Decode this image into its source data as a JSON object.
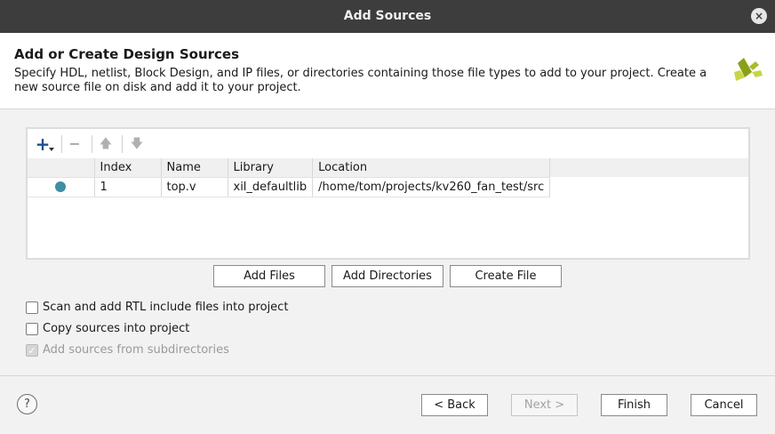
{
  "window": {
    "title": "Add Sources",
    "close_icon": "×"
  },
  "header": {
    "title": "Add or Create Design Sources",
    "description": "Specify HDL, netlist, Block Design, and IP files, or directories containing those file types to add to your project. Create a new source file on disk and add it to your project.",
    "logo_icon": "xilinx-logo-icon"
  },
  "toolbar": {
    "add_icon": "+",
    "remove_icon": "−",
    "up_icon": "🡅",
    "down_icon": "🡇"
  },
  "table": {
    "columns": [
      "",
      "Index",
      "Name",
      "Library",
      "Location"
    ],
    "rows": [
      {
        "status": "added",
        "index": "1",
        "name": "top.v",
        "library": "xil_defaultlib",
        "location": "/home/tom/projects/kv260_fan_test/src"
      }
    ]
  },
  "actions": {
    "add_files": "Add Files",
    "add_directories": "Add Directories",
    "create_file": "Create File"
  },
  "options": {
    "scan_rtl": {
      "label": "Scan and add RTL include files into project",
      "checked": false
    },
    "copy_sources": {
      "label": "Copy sources into project",
      "checked": false
    },
    "add_subdirs": {
      "label": "Add sources from subdirectories",
      "checked": true,
      "disabled": true
    }
  },
  "footer": {
    "help": "?",
    "back": "< Back",
    "next": "Next >",
    "finish": "Finish",
    "cancel": "Cancel"
  },
  "colors": {
    "titlebar": "#3d3d3d",
    "status_dot": "#3e8ea4",
    "logo_dark": "#8aa016",
    "logo_light": "#c5d64a"
  }
}
